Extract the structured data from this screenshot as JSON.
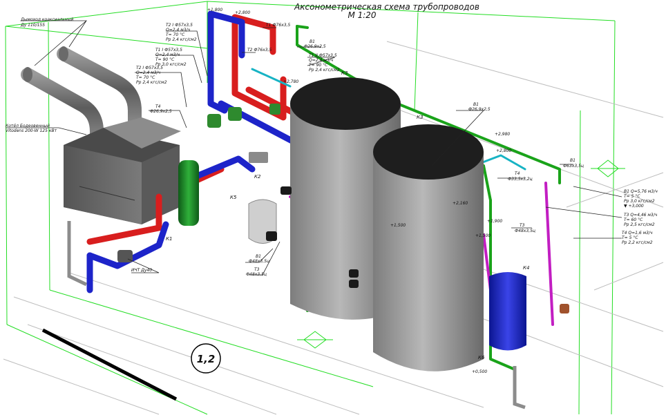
{
  "title": "Аксонометрическая схема трубопроводов",
  "scale": "М 1:20",
  "view_number": "1,2",
  "colors": {
    "hot": "#d81e1e",
    "supply": "#1d24c9",
    "cold": "#1aa31a",
    "recirc": "#c21ec2",
    "cyan": "#17b3c4",
    "frame": "#22dd22",
    "tank": "#9a9a9a",
    "tank_top": "#222222",
    "boiler": "#6c6c6c",
    "flue": "#808080",
    "separator": "#1f8a2a"
  },
  "labels": {
    "flue": [
      "Дымоход коаксиальный",
      "Ду 110/155"
    ],
    "boiler": [
      "Котёл Бодеовенный",
      "Vitodens 200-W 125 кВт"
    ],
    "t21": [
      "Т2 I Ф57х3,5",
      "Q=2,4 м3/ч",
      "T= 70 °С",
      "Рр 2,4 кгс/см2"
    ],
    "t11": [
      "Т1 Ф76х3,5"
    ],
    "t2": [
      "Т2 Ф76х3,5"
    ],
    "t12": [
      "Т1 I Ф57х3,5",
      "Q=2,4 м3/ч",
      "T= 90 °С",
      "Рр 3,0 кгс/см2"
    ],
    "t22": [
      "Т2 I Ф57х3,5",
      "Q=2,4 м3/ч",
      "T= 70 °С",
      "Рр 2,4 кгс/см2"
    ],
    "t4": [
      "Т4",
      "Ф26,9х2,5"
    ],
    "v1a": [
      "В1",
      "Ф26,9х2,5"
    ],
    "t1ii": [
      "Т1 II Ф57х3,5",
      "Q=2,4 м3/ч",
      "T= 90 °С",
      "Рр 2,4 кгс/см2"
    ],
    "k3": [
      "К3"
    ],
    "k3b": [
      "К3"
    ],
    "v1b": [
      "В1",
      "Ф26,9х2,5"
    ],
    "v1c": [
      "В1",
      "Ф63х3,5ц"
    ],
    "t4b": [
      "Т4",
      "Ф33,5х3,2ц"
    ],
    "t3a": [
      "Т3",
      "Ф48х3,5ц"
    ],
    "v1right": [
      "В1 Q=5,76 м3/ч",
      "Т= 5 °С",
      "Рр 3,0 кгс/см2",
      "▼ +3,000"
    ],
    "t3right": [
      "Т3 Q=4,46 м3/ч",
      "Т= 60 °С",
      "Рр 2,5 кгс/см2"
    ],
    "t4right": [
      "Т4 Q=1,6 м3/ч",
      "Т= 5 °С",
      "Рр 2,2 кгс/см2"
    ],
    "k1": [
      "К1"
    ],
    "k2": [
      "К2"
    ],
    "k5": [
      "К5"
    ],
    "k4": [
      "К4"
    ],
    "k6": [
      "К6"
    ],
    "ip": [
      "ИЧТ Ду40"
    ],
    "v1bottom": [
      "В1",
      "Ф48х3,5ц"
    ],
    "t3bottom": [
      "Т3",
      "Ф48х3,5ц"
    ],
    "lev1": "+1,800",
    "lev2": "+2,800",
    "lev3": "+2,780",
    "lev4": "+2,980",
    "lev5": "+2,800",
    "lev6": "+2,160",
    "lev7": "+1,900",
    "lev8": "+1,500",
    "lev9": "+1,500",
    "lev10": "+0,500"
  }
}
